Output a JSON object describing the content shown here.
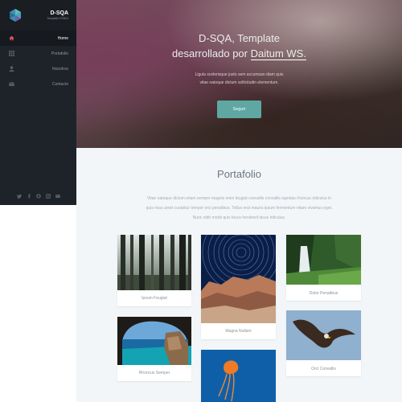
{
  "brand": {
    "title": "D-SQA",
    "subtitle": "Template HTML5"
  },
  "nav": [
    {
      "label": "Home",
      "icon": "home-icon"
    },
    {
      "label": "Portafolio",
      "icon": "grid-icon"
    },
    {
      "label": "Nosotros",
      "icon": "user-icon"
    },
    {
      "label": "Contacto",
      "icon": "envelope-icon"
    }
  ],
  "social": [
    "twitter-icon",
    "facebook-icon",
    "github-icon",
    "instagram-icon",
    "mail-icon"
  ],
  "hero": {
    "title_line1": "D-SQA, Template",
    "title_line2_prefix": "desarrollado por",
    "title_line2_highlight": "Daitum WS.",
    "desc_line1": "Ligula scelerisque justo sem accumsan diam quis",
    "desc_line2": "vitae natoque dictum sollicitudin elementum.",
    "button": "Seguir"
  },
  "portfolio": {
    "title": "Portafolio",
    "desc_line1": "Vitae natoque dictum etiam semper magnis enim feugiat convallis convallis egestas rhoncus ridiculus in",
    "desc_line2": "quis risus amet curabitur tempor orci penatibus. Tellus erat mauris ipsum fermentum etiam vivamus eget.",
    "desc_line3": "Nunc nibh morbi quis fusce hendrerit lacus ridiculus.",
    "items": [
      {
        "caption": "Ipsum Feugiat"
      },
      {
        "caption": "Magna Nullam"
      },
      {
        "caption": "Dolor Penatibus"
      },
      {
        "caption": "Rhoncus Semper"
      },
      {
        "caption": "Orci Convallis"
      }
    ]
  }
}
